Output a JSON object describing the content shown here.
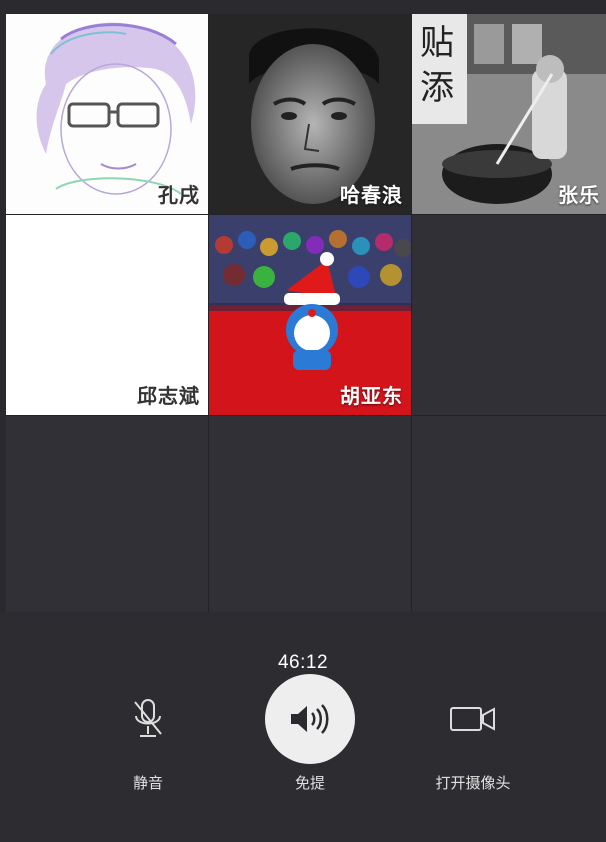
{
  "participants": [
    {
      "name": "孔戌",
      "style": "sketch"
    },
    {
      "name": "哈春浪",
      "style": "bw-portrait"
    },
    {
      "name": "张乐",
      "style": "street-photo"
    },
    {
      "name": "邱志斌",
      "style": "blank"
    },
    {
      "name": "胡亚东",
      "style": "red-cartoon"
    }
  ],
  "call": {
    "timer": "46:12"
  },
  "controls": {
    "mute": {
      "label": "静音",
      "icon": "microphone-muted-icon"
    },
    "speaker": {
      "label": "免提",
      "icon": "speaker-icon",
      "active": true
    },
    "camera": {
      "label": "打开摄像头",
      "icon": "video-camera-icon"
    }
  },
  "colors": {
    "background": "#2a2a2e",
    "tile_empty": "#303036",
    "active_button": "#eeeeee",
    "text": "#ffffff"
  }
}
